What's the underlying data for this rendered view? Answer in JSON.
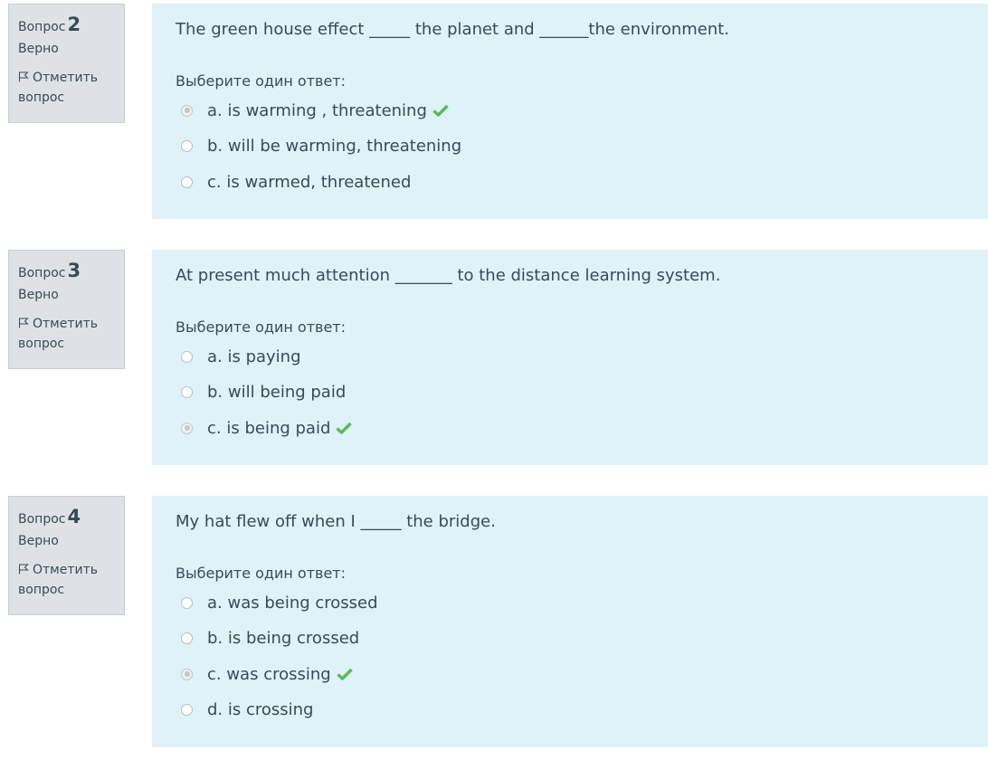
{
  "labels": {
    "question": "Вопрос",
    "flag": "Отметить вопрос",
    "prompt": "Выберите один ответ:"
  },
  "colors": {
    "panel_bg": "#def2f8",
    "info_bg": "#dee2e6",
    "text": "#3a4a55",
    "correct": "#5cb85c"
  },
  "questions": [
    {
      "number": "2",
      "state": "Верно",
      "text": "The green house effect _____ the planet and ______the environment.",
      "answers": [
        {
          "label": "a. is warming , threatening",
          "selected": true,
          "correct": true
        },
        {
          "label": "b. will be warming, threatening",
          "selected": false,
          "correct": false
        },
        {
          "label": "c. is warmed, threatened",
          "selected": false,
          "correct": false
        }
      ]
    },
    {
      "number": "3",
      "state": "Верно",
      "text": "At present much attention _______ to the distance learning system.",
      "answers": [
        {
          "label": "a. is paying",
          "selected": false,
          "correct": false
        },
        {
          "label": "b. will being paid",
          "selected": false,
          "correct": false
        },
        {
          "label": "c. is being paid",
          "selected": true,
          "correct": true
        }
      ]
    },
    {
      "number": "4",
      "state": "Верно",
      "text": "My hat flew off when I _____ the bridge.",
      "answers": [
        {
          "label": "a. was being crossed",
          "selected": false,
          "correct": false
        },
        {
          "label": "b. is being crossed",
          "selected": false,
          "correct": false
        },
        {
          "label": "c. was crossing",
          "selected": true,
          "correct": true
        },
        {
          "label": "d. is crossing",
          "selected": false,
          "correct": false
        }
      ]
    }
  ]
}
